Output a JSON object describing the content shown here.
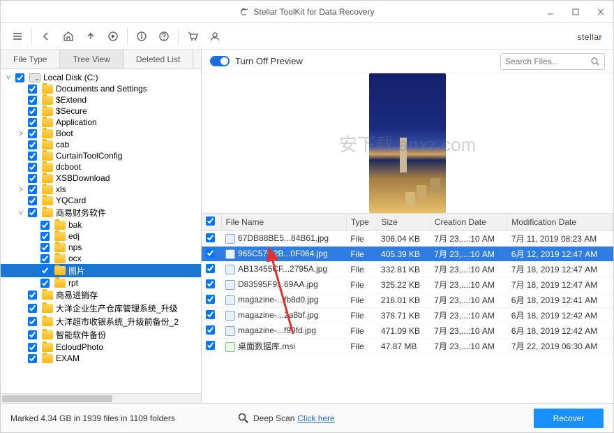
{
  "window": {
    "title": "Stellar ToolKit for Data Recovery",
    "brand_part1": "stel",
    "brand_part2": "l",
    "brand_part3": "ar"
  },
  "left_tabs": [
    "File Type",
    "Tree View",
    "Deleted List"
  ],
  "left_active_tab": 1,
  "tree": {
    "root": {
      "label": "Local Disk (C:)",
      "expanded": true,
      "drive": true,
      "children": [
        {
          "label": "Documents and Settings"
        },
        {
          "label": "$Extend"
        },
        {
          "label": "$Secure"
        },
        {
          "label": "Application"
        },
        {
          "label": "Boot",
          "hasChildren": true
        },
        {
          "label": "cab"
        },
        {
          "label": "CurtainToolConfig"
        },
        {
          "label": "dcboot"
        },
        {
          "label": "XSBDownload"
        },
        {
          "label": "xls",
          "hasChildren": true
        },
        {
          "label": "YQCard"
        },
        {
          "label": "商易财务软件",
          "expanded": true,
          "children": [
            {
              "label": "bak"
            },
            {
              "label": "edj"
            },
            {
              "label": "nps"
            },
            {
              "label": "ocx"
            },
            {
              "label": "图片",
              "selected": true
            },
            {
              "label": "rpt"
            }
          ]
        },
        {
          "label": "商易进销存"
        },
        {
          "label": "大洋企业生产仓库管理系统_升级"
        },
        {
          "label": "大洋超市收银系统_升级前备份_2"
        },
        {
          "label": "智能软件备份"
        },
        {
          "label": "EcloudPhoto"
        },
        {
          "label": "EXAM"
        }
      ]
    }
  },
  "preview_toggle_label": "Turn Off Preview",
  "search_placeholder": "Search Files...",
  "watermark_text": "安下载 anxz.com",
  "columns": [
    "File Name",
    "Type",
    "Size",
    "Creation Date",
    "Modification Date"
  ],
  "files": [
    {
      "name": "67DB88BE5...84B61.jpg",
      "type": "File",
      "size": "306.04 KB",
      "created": "7月 23,...:10 AM",
      "modified": "7月 11, 2019 08:23 AM",
      "icon": "img"
    },
    {
      "name": "965C57C2B...0F064.jpg",
      "type": "File",
      "size": "405.39 KB",
      "created": "7月 23,...:10 AM",
      "modified": "6月 12, 2019 12:47 AM",
      "icon": "img",
      "selected": true
    },
    {
      "name": "AB13455CF...2795A.jpg",
      "type": "File",
      "size": "332.81 KB",
      "created": "7月 23,...:10 AM",
      "modified": "7月 18, 2019 12:47 AM",
      "icon": "img"
    },
    {
      "name": "D83595F9...69AA.jpg",
      "type": "File",
      "size": "325.22 KB",
      "created": "7月 23,...:10 AM",
      "modified": "7月 18, 2019 12:47 AM",
      "icon": "img"
    },
    {
      "name": "magazine-...fb8d0.jpg",
      "type": "File",
      "size": "216.01 KB",
      "created": "7月 23,...:10 AM",
      "modified": "6月 18, 2019 12:41 AM",
      "icon": "img"
    },
    {
      "name": "magazine-...2a8bf.jpg",
      "type": "File",
      "size": "378.71 KB",
      "created": "7月 23,...:10 AM",
      "modified": "6月 18, 2019 12:42 AM",
      "icon": "img"
    },
    {
      "name": "magazine-...f90fd.jpg",
      "type": "File",
      "size": "471.09 KB",
      "created": "7月 23,...:10 AM",
      "modified": "6月 18, 2019 12:42 AM",
      "icon": "img"
    },
    {
      "name": "桌面数据库.msi",
      "type": "File",
      "size": "47.87 MB",
      "created": "7月 23,...:10 AM",
      "modified": "7月 22, 2019 06:30 AM",
      "icon": "msi"
    }
  ],
  "status": {
    "marked_text": "Marked 4.34 GB in 1939 files in 1109 folders",
    "deep_scan_label": "Deep Scan",
    "deep_scan_link": "Click here",
    "recover_label": "Recover"
  }
}
